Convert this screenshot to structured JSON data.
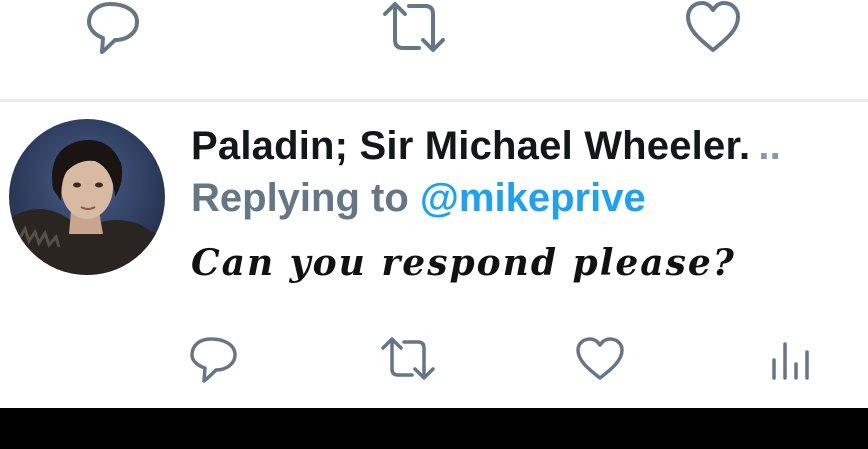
{
  "tweet": {
    "display_name": "Paladin; Sir Michael Wheeler.",
    "name_overflow": "..",
    "replying_prefix": "Replying to",
    "reply_handle": "@mikeprive",
    "text": "Can you respond please?"
  },
  "icons": {
    "reply": "speech-bubble",
    "retweet": "retweet-arrows",
    "like": "heart",
    "analytics": "bar-chart"
  },
  "colors": {
    "icon": "#657786",
    "name": "#14171a",
    "muted": "#657786",
    "link": "#1da1f2",
    "divider": "#e6ecf0"
  }
}
